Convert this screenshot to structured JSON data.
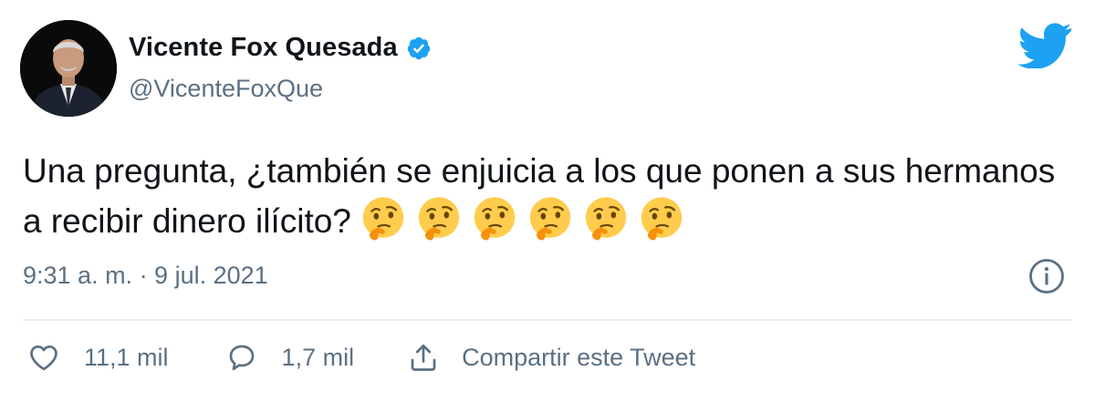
{
  "author": {
    "display_name": "Vicente Fox Quesada",
    "handle": "@VicenteFoxQue",
    "verified": true,
    "avatar_icon": "profile-photo"
  },
  "tweet": {
    "text": "Una pregunta, ¿también se enjuicia a los que ponen a sus hermanos a recibir dinero ilícito?",
    "emojis": [
      "thinking-face",
      "thinking-face",
      "thinking-face",
      "thinking-face",
      "thinking-face",
      "thinking-face"
    ],
    "timestamp": "9:31 a. m. · 9 jul. 2021"
  },
  "actions": {
    "likes_count": "11,1 mil",
    "replies_count": "1,7 mil",
    "share_label": "Compartir este Tweet"
  },
  "colors": {
    "twitter_blue": "#1da1f2",
    "secondary_text": "#5b7083",
    "divider": "#e6ecf0"
  }
}
